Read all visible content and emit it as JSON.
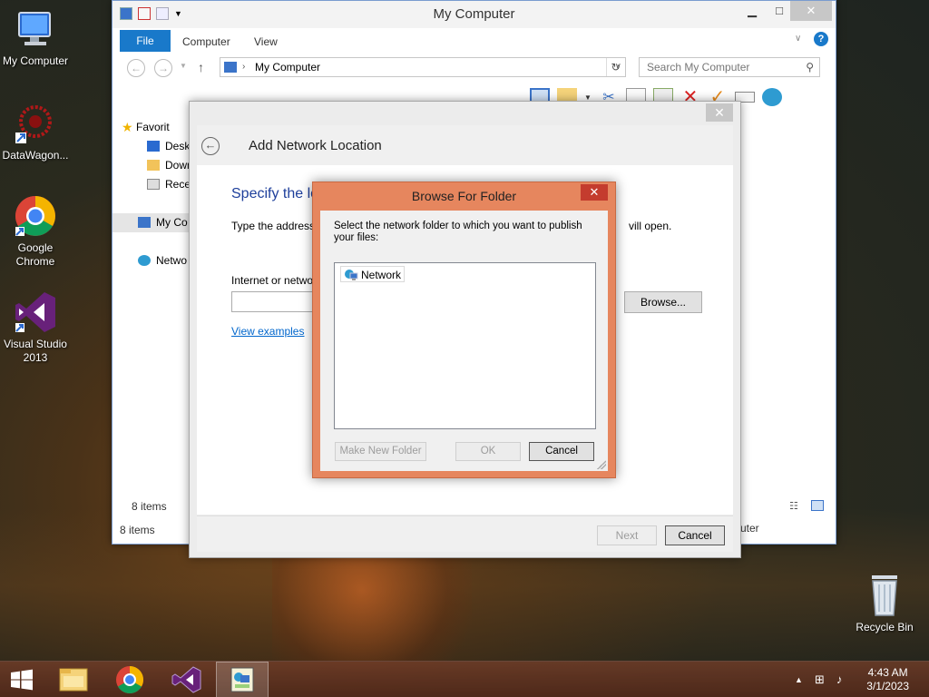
{
  "desktop": {
    "icons": [
      {
        "label": "My Computer",
        "icon": "computer-icon"
      },
      {
        "label": "DataWagon...",
        "icon": "datawagon-icon"
      },
      {
        "label": "Google Chrome",
        "icon": "chrome-icon"
      },
      {
        "label": "Visual Studio 2013",
        "icon": "visual-studio-icon"
      },
      {
        "label": "Recycle Bin",
        "icon": "recycle-bin-icon"
      }
    ]
  },
  "explorer": {
    "title": "My Computer",
    "tabs": {
      "file": "File",
      "computer": "Computer",
      "view": "View"
    },
    "address": "My Computer",
    "search_placeholder": "Search My Computer",
    "nav_items": [
      "Favorit",
      "Desk",
      "Down",
      "Rece",
      "My Co",
      "Netwo"
    ],
    "status_items": "8 items",
    "status_items_bottom": "8 items",
    "partial_right": "uter"
  },
  "wizard": {
    "title": "Add Network Location",
    "heading": "Specify the lo",
    "desc_left": "Type the address",
    "desc_right": "vill open.",
    "input_label": "Internet or netwo",
    "browse_label": "Browse...",
    "examples_link": "View examples",
    "next_label": "Next",
    "cancel_label": "Cancel"
  },
  "browse_dialog": {
    "title": "Browse For Folder",
    "instruction": "Select the network folder to which you want to publish your files:",
    "tree_items": [
      "Network"
    ],
    "make_new_folder": "Make New Folder",
    "ok": "OK",
    "cancel": "Cancel"
  },
  "taskbar": {
    "time": "4:43 AM",
    "date": "3/1/2023"
  },
  "colors": {
    "accent_file_tab": "#1979ca",
    "dialog_frame": "#e6865e",
    "close_red": "#c43c2e",
    "heading_blue": "#1e3f9b",
    "link_blue": "#0066cc"
  }
}
